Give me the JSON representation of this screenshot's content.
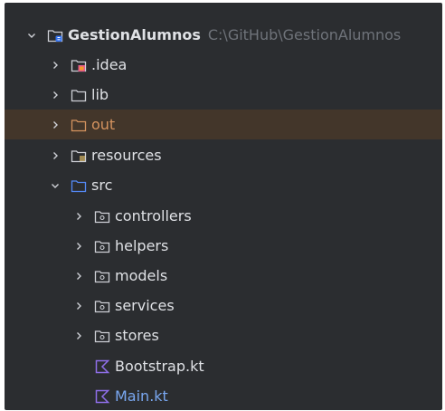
{
  "tree": {
    "root": {
      "name": "GestionAlumnos",
      "path": "C:\\GitHub\\GestionAlumnos",
      "expanded": true,
      "icon": "project-folder-icon"
    },
    "items": [
      {
        "label": ".idea",
        "icon": "idea-folder-icon",
        "expanded": false
      },
      {
        "label": "lib",
        "icon": "folder-icon",
        "expanded": false
      },
      {
        "label": "out",
        "icon": "folder-icon",
        "expanded": false,
        "selected": true,
        "color": "#d5935f"
      },
      {
        "label": "resources",
        "icon": "resources-folder-icon",
        "expanded": false
      },
      {
        "label": "src",
        "icon": "source-folder-icon",
        "expanded": true,
        "color": "#548af7"
      }
    ],
    "src_children": [
      {
        "label": "controllers",
        "icon": "package-icon",
        "expanded": false
      },
      {
        "label": "helpers",
        "icon": "package-icon",
        "expanded": false
      },
      {
        "label": "models",
        "icon": "package-icon",
        "expanded": false
      },
      {
        "label": "services",
        "icon": "package-icon",
        "expanded": false
      },
      {
        "label": "stores",
        "icon": "package-icon",
        "expanded": false
      }
    ],
    "files": [
      {
        "label": "Bootstrap.kt",
        "icon": "kotlin-file-icon"
      },
      {
        "label": "Main.kt",
        "icon": "kotlin-file-icon",
        "highlighted": true
      }
    ]
  },
  "colors": {
    "background": "#2b2d30",
    "text": "#dfe1e5",
    "path_text": "#6f737a",
    "selected_row": "#43362a",
    "excluded_folder": "#d5935f",
    "source_folder": "#548af7",
    "kotlin_icon": "#8f6fe9",
    "highlighted_file": "#79a7f0"
  }
}
